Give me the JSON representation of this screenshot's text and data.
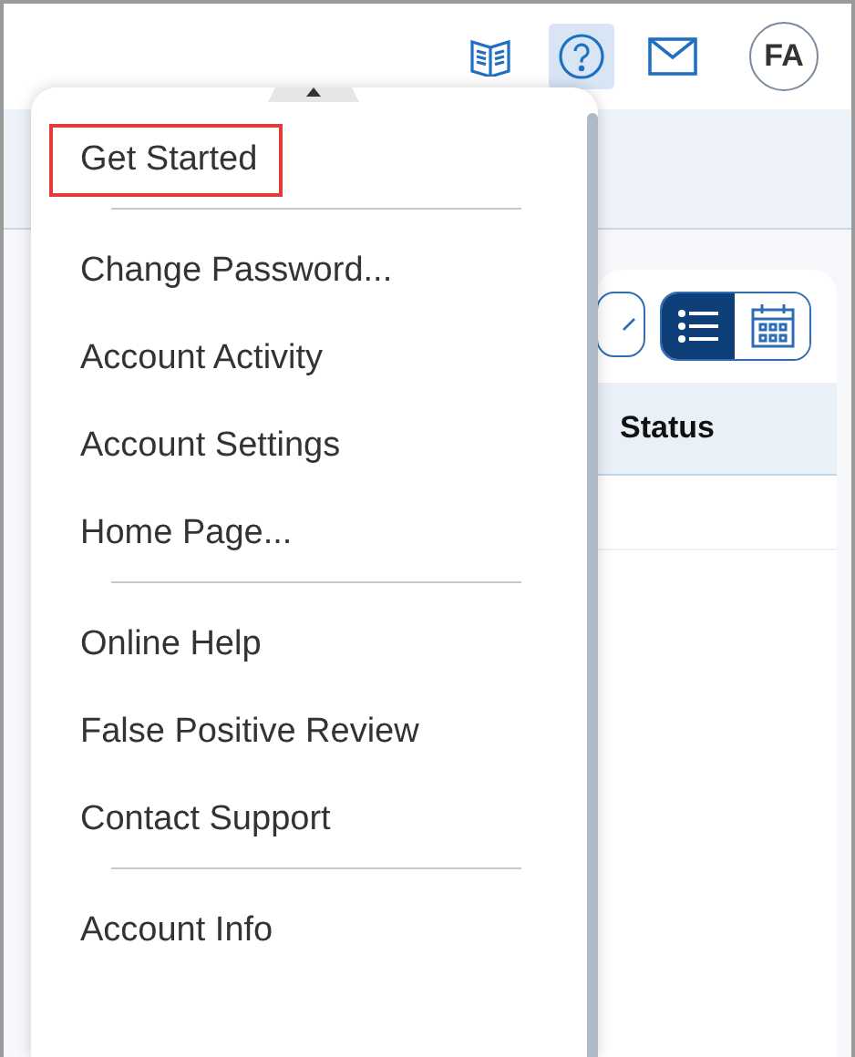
{
  "header": {
    "icons": [
      {
        "kind": "book",
        "selected": false
      },
      {
        "kind": "help",
        "selected": true
      },
      {
        "kind": "mail",
        "selected": false
      }
    ],
    "avatar": "FA"
  },
  "view_toggle": [
    {
      "kind": "list",
      "selected": true
    },
    {
      "kind": "calendar",
      "selected": false
    }
  ],
  "table": {
    "columns": [
      "Status"
    ]
  },
  "menu": {
    "groups": [
      [
        {
          "label": "Get Started",
          "highlighted": true
        }
      ],
      [
        {
          "label": "Change Password...",
          "highlighted": false
        },
        {
          "label": "Account Activity",
          "highlighted": false
        },
        {
          "label": "Account Settings",
          "highlighted": false
        },
        {
          "label": "Home Page...",
          "highlighted": false
        }
      ],
      [
        {
          "label": "Online Help",
          "highlighted": false
        },
        {
          "label": "False Positive Review",
          "highlighted": false
        },
        {
          "label": "Contact Support",
          "highlighted": false
        }
      ],
      [
        {
          "label": "Account Info",
          "highlighted": false
        }
      ]
    ]
  }
}
